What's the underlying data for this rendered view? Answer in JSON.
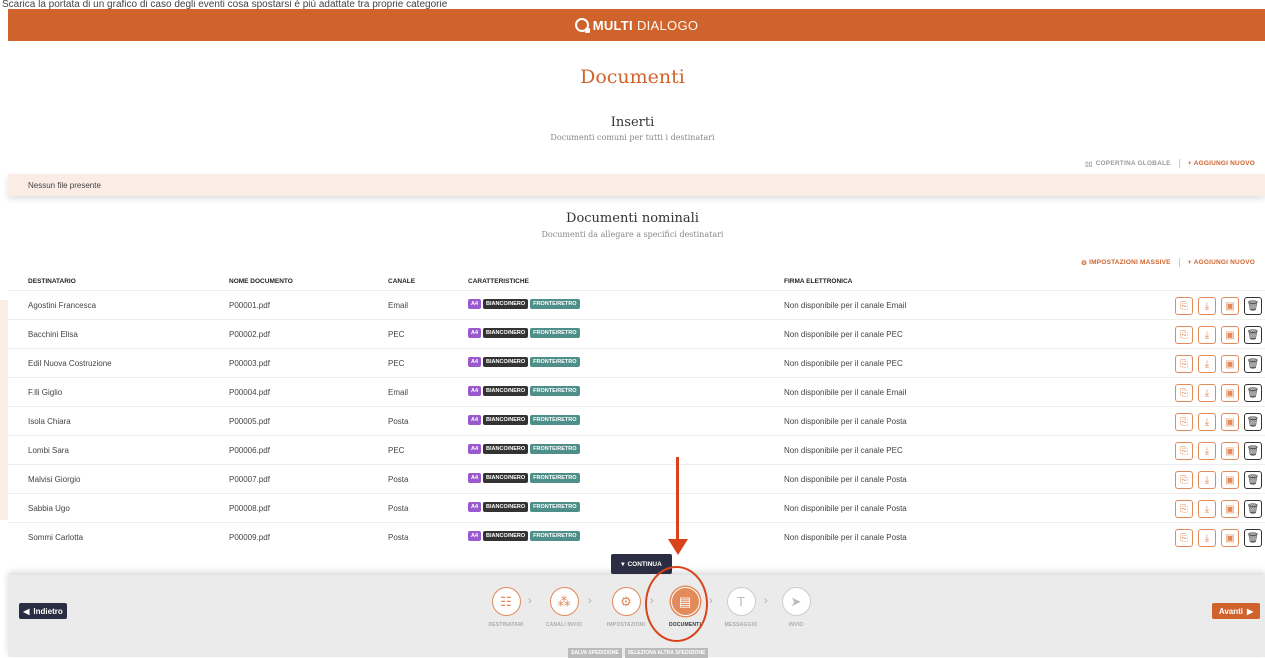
{
  "caption": "Scarica la portata di un grafico di caso degli eventi cosa spostarsi è più adattate tra proprie categorie",
  "brand": {
    "bold": "MULTI",
    "rest": "DIALOGO"
  },
  "page_title": "Documenti",
  "inserti": {
    "title": "Inserti",
    "subtitle": "Documenti comuni per tutti i destinatari",
    "action_cover": "COPERTINA GLOBALE",
    "action_add": "AGGIUNGI NUOVO",
    "empty": "Nessun file presente"
  },
  "nominali": {
    "title": "Documenti nominali",
    "subtitle": "Documenti da allegare a specifici destinatari",
    "action_bulk": "IMPOSTAZIONI MASSIVE",
    "action_add": "AGGIUNGI NUOVO",
    "columns": {
      "dest": "DESTINATARIO",
      "doc": "NOME DOCUMENTO",
      "canale": "CANALE",
      "caratt": "CARATTERISTICHE",
      "firma": "FIRMA ELETTRONICA"
    },
    "badges": {
      "size": "A4",
      "color": "BIANCO/NERO",
      "side": "FRONTE/RETRO"
    },
    "rows": [
      {
        "dest": "Agostini Francesca",
        "doc": "P00001.pdf",
        "canale": "Email",
        "firma": "Non disponibile per il canale Email"
      },
      {
        "dest": "Bacchini Elisa",
        "doc": "P00002.pdf",
        "canale": "PEC",
        "firma": "Non disponibile per il canale PEC"
      },
      {
        "dest": "Edil Nuova Costruzione",
        "doc": "P00003.pdf",
        "canale": "PEC",
        "firma": "Non disponibile per il canale PEC"
      },
      {
        "dest": "F.lli Giglio",
        "doc": "P00004.pdf",
        "canale": "Email",
        "firma": "Non disponibile per il canale Email"
      },
      {
        "dest": "Isola Chiara",
        "doc": "P00005.pdf",
        "canale": "Posta",
        "firma": "Non disponibile per il canale Posta"
      },
      {
        "dest": "Lombi Sara",
        "doc": "P00006.pdf",
        "canale": "PEC",
        "firma": "Non disponibile per il canale PEC"
      },
      {
        "dest": "Malvisi Giorgio",
        "doc": "P00007.pdf",
        "canale": "Posta",
        "firma": "Non disponibile per il canale Posta"
      },
      {
        "dest": "Sabbia Ugo",
        "doc": "P00008.pdf",
        "canale": "Posta",
        "firma": "Non disponibile per il canale Posta"
      },
      {
        "dest": "Sommi Carlotta",
        "doc": "P00009.pdf",
        "canale": "Posta",
        "firma": "Non disponibile per il canale Posta"
      }
    ]
  },
  "continua": "CONTINUA",
  "footer": {
    "back": "Indietro",
    "next": "Avanti",
    "steps": [
      "DESTINATARI",
      "CANALI INVIO",
      "IMPOSTAZIONI",
      "DOCUMENTI",
      "MESSAGGIO",
      "INVIO"
    ],
    "save": "SALVA SPEDIZIONE",
    "select": "SELEZIONA ALTRA SPEDIZIONE"
  },
  "colors": {
    "accent": "#d0632b",
    "dark": "#2b2d42",
    "annotation": "#d9431c"
  }
}
